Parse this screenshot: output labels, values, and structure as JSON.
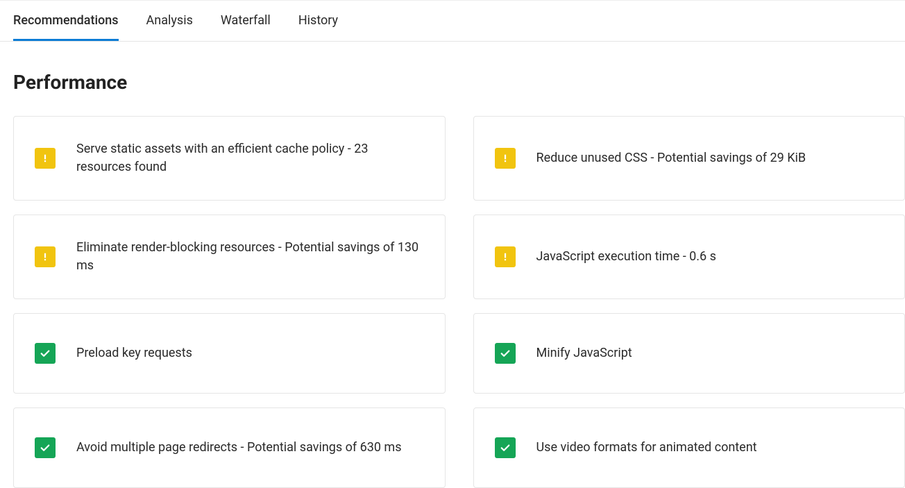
{
  "tabs": {
    "recommendations": "Recommendations",
    "analysis": "Analysis",
    "waterfall": "Waterfall",
    "history": "History"
  },
  "section": {
    "title": "Performance"
  },
  "cards": {
    "c0": {
      "status": "warning",
      "text": "Serve static assets with an efficient cache policy - 23 resources found"
    },
    "c1": {
      "status": "warning",
      "text": "Reduce unused CSS - Potential savings of 29 KiB"
    },
    "c2": {
      "status": "warning",
      "text": "Eliminate render-blocking resources - Potential savings of 130 ms"
    },
    "c3": {
      "status": "warning",
      "text": "JavaScript execution time - 0.6 s"
    },
    "c4": {
      "status": "success",
      "text": "Preload key requests"
    },
    "c5": {
      "status": "success",
      "text": "Minify JavaScript"
    },
    "c6": {
      "status": "success",
      "text": "Avoid multiple page redirects - Potential savings of 630 ms"
    },
    "c7": {
      "status": "success",
      "text": "Use video formats for animated content"
    }
  }
}
